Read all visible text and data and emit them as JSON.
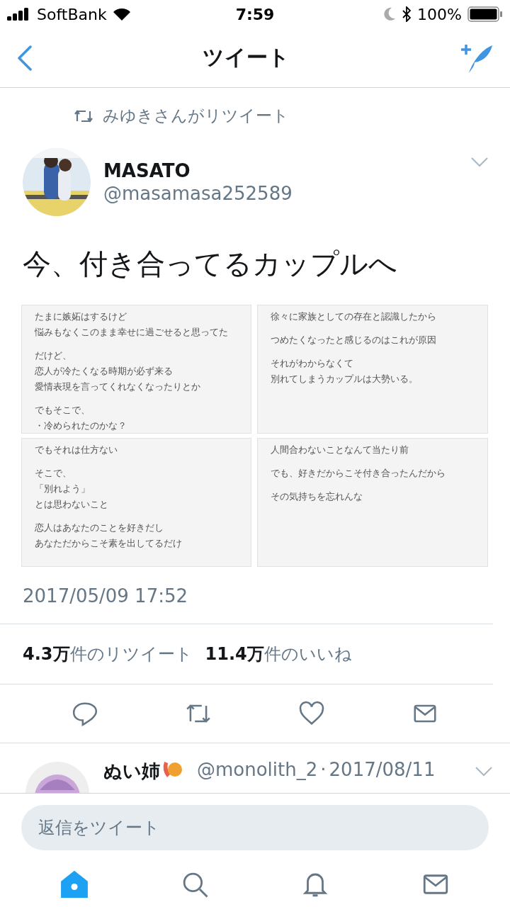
{
  "status_bar": {
    "carrier": "SoftBank",
    "time": "7:59",
    "battery": "100%"
  },
  "nav": {
    "title": "ツイート"
  },
  "retweeted_by": "みゆきさんがリツイート",
  "tweet": {
    "name": "MASATO",
    "handle": "@masamasa252589",
    "text": "今、付き合ってるカップルへ",
    "images": [
      {
        "paragraphs": [
          [
            "たまに嫉妬はするけど",
            "悩みもなくこのまま幸せに過ごせると思ってた"
          ],
          [
            "だけど、",
            "恋人が冷たくなる時期が必ず来る",
            "愛情表現を言ってくれなくなったりとか"
          ],
          [
            "でもそこで、",
            "・冷められたのかな？"
          ]
        ]
      },
      {
        "paragraphs": [
          [
            "徐々に家族としての存在と認識したから"
          ],
          [
            "つめたくなったと感じるのはこれが原因"
          ],
          [
            "それがわからなくて",
            "別れてしまうカップルは大勢いる。"
          ]
        ]
      },
      {
        "paragraphs": [
          [
            "でもそれは仕方ない"
          ],
          [
            "そこで、",
            "「別れよう」",
            "とは思わないこと"
          ],
          [
            "恋人はあなたのことを好きだし",
            "あなただからこそ素を出してるだけ"
          ]
        ]
      },
      {
        "paragraphs": [
          [
            "人間合わないことなんて当たり前"
          ],
          [
            "でも、好きだからこそ付き合ったんだから"
          ],
          [
            "その気持ちを忘れんな"
          ]
        ]
      }
    ],
    "timestamp": "2017/05/09 17:52",
    "stats": [
      {
        "count": "4.3万",
        "label": "件のリツイート"
      },
      {
        "count": "11.4万",
        "label": "件のいいね"
      }
    ]
  },
  "reply": {
    "name": "ぬい姉",
    "handle": "@monolith_2",
    "separator": "·",
    "date": "2017/08/11"
  },
  "reply_field": {
    "placeholder": "返信をツイート"
  },
  "tab_bar": [
    {
      "kind": "home",
      "selected": true
    },
    {
      "kind": "search",
      "selected": false
    },
    {
      "kind": "notifications",
      "selected": false
    },
    {
      "kind": "messages",
      "selected": false
    }
  ]
}
